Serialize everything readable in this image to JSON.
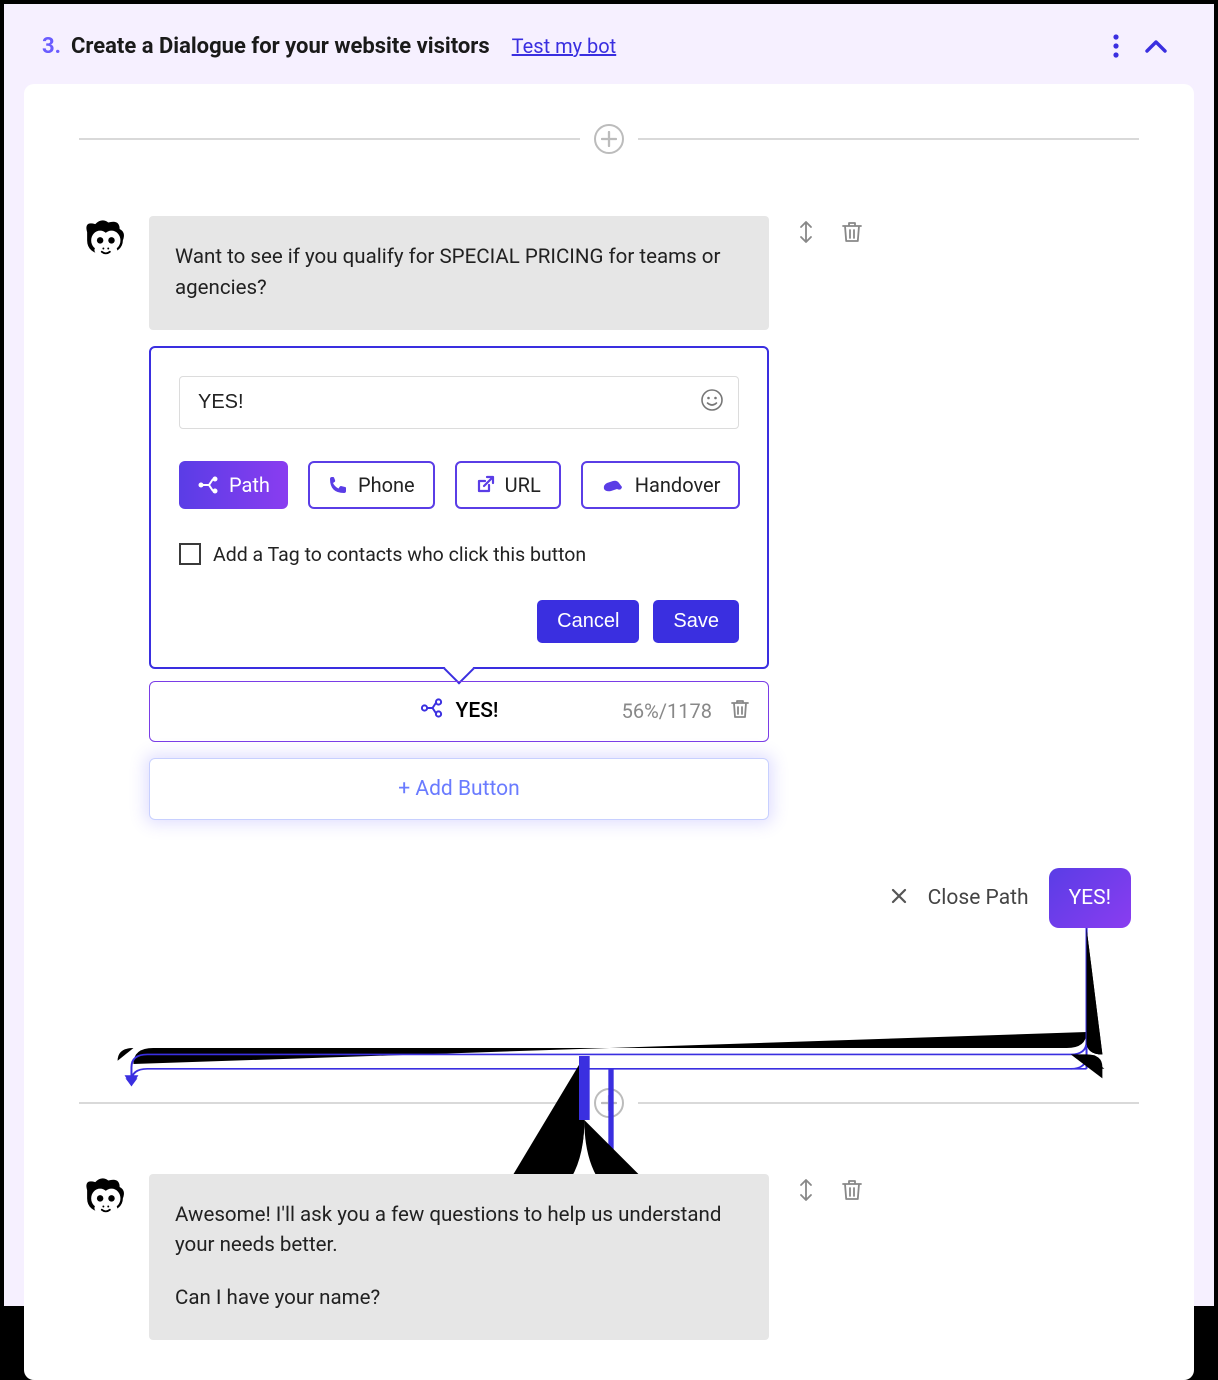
{
  "header": {
    "step_number": "3.",
    "title": "Create a Dialogue for your website visitors",
    "test_link": "Test my bot"
  },
  "messages": {
    "msg1": {
      "text": "Want to see if you qualify for SPECIAL PRICING for teams or agencies?"
    },
    "msg2": {
      "line1": "Awesome! I'll ask you a few questions to help us understand your needs better.",
      "line2": "Can I have your name?"
    }
  },
  "editor": {
    "input_value": "YES!",
    "actions": {
      "path": "Path",
      "phone": "Phone",
      "url": "URL",
      "handover": "Handover"
    },
    "tag_label": "Add a Tag to contacts who click this button",
    "cancel": "Cancel",
    "save": "Save"
  },
  "yes_row": {
    "label": "YES!",
    "stats": "56%/1178"
  },
  "add_button_label": "+ Add Button",
  "close_path": {
    "label": "Close Path",
    "pill": "YES!"
  }
}
